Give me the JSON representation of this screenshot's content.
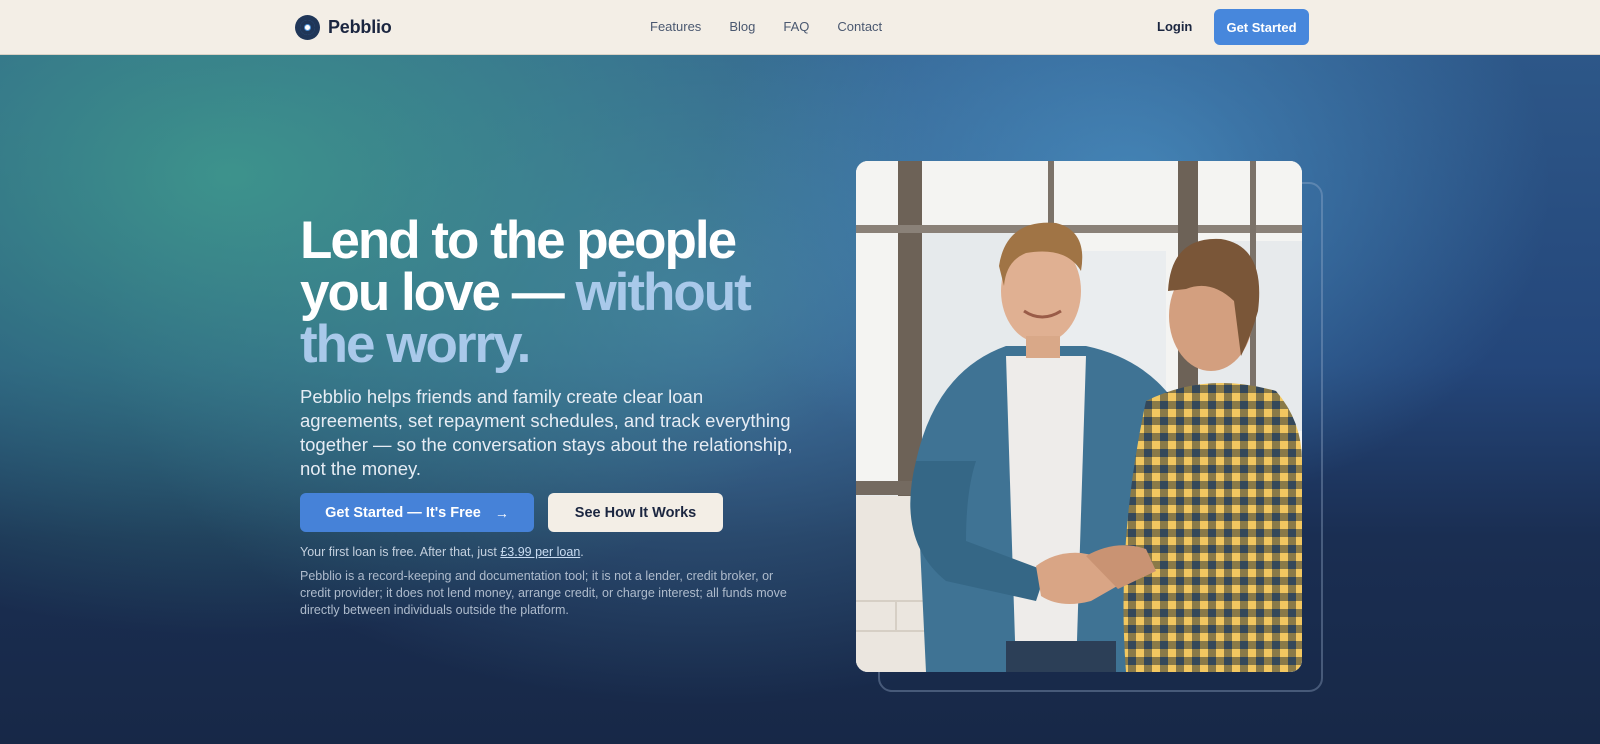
{
  "nav": {
    "brand": "Pebblio",
    "links": [
      "Features",
      "Blog",
      "FAQ",
      "Contact"
    ],
    "login": "Login",
    "cta": "Get Started"
  },
  "hero": {
    "headline_main": "Lend to the people you love — ",
    "headline_accent": "without the worry.",
    "subcopy": "Pebblio helps friends and family create clear loan agreements, set repayment schedules, and track everything together — so the conversation stays about the relationship, not the money.",
    "primary_cta": "Get Started — It's Free",
    "primary_cta_icon": "arrow-right-icon",
    "secondary_cta": "See How It Works",
    "pricing_prefix": "Your first loan is free. After that, just ",
    "pricing_link": "£3.99 per loan",
    "pricing_suffix": ".",
    "disclaimer": "Pebblio is a record-keeping and documentation tool; it is not a lender, credit broker, or credit provider; it does not lend money, arrange credit, or charge interest; all funds move directly between individuals outside the platform."
  },
  "colors": {
    "accent": "#4787dc",
    "nav_bg": "#f3eee6",
    "headline_accent": "#a9c9ea"
  }
}
